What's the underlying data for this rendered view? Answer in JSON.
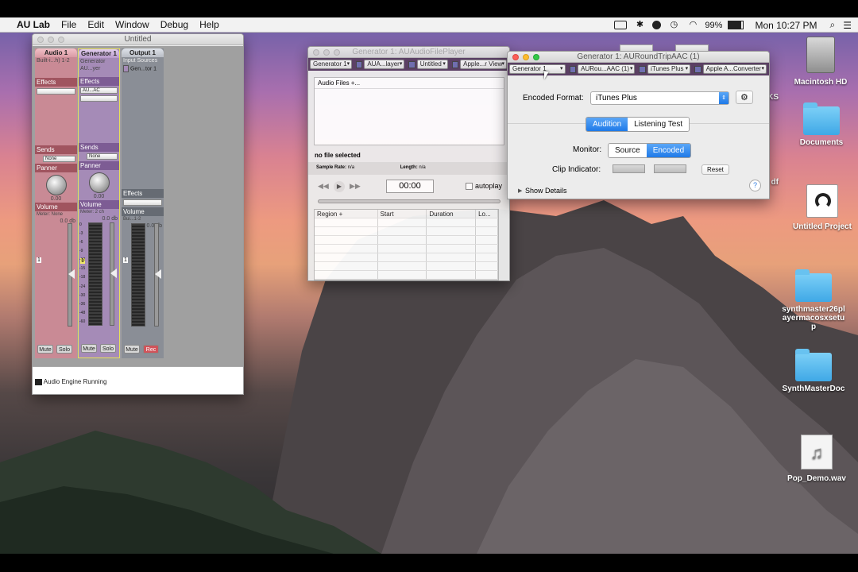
{
  "menubar": {
    "app_name": "AU Lab",
    "menus": [
      "File",
      "Edit",
      "Window",
      "Debug",
      "Help"
    ],
    "battery": "99%",
    "clock": "Mon 10:27 PM"
  },
  "main_window": {
    "title": "Untitled",
    "status": "Audio Engine Running",
    "strips": [
      {
        "header": "Audio 1",
        "input": "Built-i...h) 1-2",
        "effects_label": "Effects",
        "sends_label": "Sends",
        "send_value": "None",
        "panner_label": "Panner",
        "pan_value": "0.00",
        "volume_label": "Volume",
        "meter_label": "Meter: None",
        "db": "0.0",
        "mute": "Mute",
        "solo": "Solo",
        "track": "1"
      },
      {
        "header": "Generator 1",
        "input": "Generator",
        "plugin": "AU...yer",
        "effects_label": "Effects",
        "effect_value": "AU...AC",
        "sends_label": "Sends",
        "send_value": "None",
        "panner_label": "Panner",
        "pan_value": "0.00",
        "volume_label": "Volume",
        "meter_label": "Meter: 2 ch",
        "db": "0.0",
        "mute": "Mute",
        "solo": "Solo",
        "track": "1"
      },
      {
        "header": "Output 1",
        "input": "Input Sources",
        "source": "Gen...tor 1",
        "effects_label": "Effects",
        "volume_label": "Volume",
        "meter_label": "Bui...1-2",
        "db": "0.0",
        "mute": "Mute",
        "rec": "Rec",
        "track": "1"
      }
    ],
    "meter_scale": [
      "0",
      "-3",
      "-6",
      "-9",
      "-12",
      "-15",
      "-18",
      "-24",
      "-30",
      "-36",
      "-48",
      "-60"
    ],
    "db_unit": "db"
  },
  "player_window": {
    "title": "Generator 1: AUAudioFilePlayer",
    "toolbar": [
      "Generator 1",
      "AUA...layer",
      "Untitled",
      "Apple...r View"
    ],
    "audio_files_label": "Audio Files +...",
    "no_file": "no file selected",
    "sample_rate_label": "Sample Rate:",
    "sample_rate_value": "n/a",
    "length_label": "Length:",
    "length_value": "n/a",
    "time": "00:00",
    "autoplay": "autoplay",
    "columns": [
      "Region +",
      "Start",
      "Duration",
      "Lo..."
    ]
  },
  "aac_window": {
    "title": "Generator 1: AURoundTripAAC (1)",
    "toolbar": [
      "Generator 1",
      "AURou...AAC (1)",
      "iTunes Plus",
      "Apple A...Converter"
    ],
    "encoded_format_label": "Encoded Format:",
    "encoded_format_value": "iTunes Plus",
    "tabs": [
      "Audition",
      "Listening Test"
    ],
    "monitor_label": "Monitor:",
    "monitor_options": [
      "Source",
      "Encoded"
    ],
    "clip_label": "Clip Indicator:",
    "reset": "Reset",
    "show_details": "Show Details",
    "help": "?"
  },
  "desktop_icons": [
    {
      "label": "Macintosh HD"
    },
    {
      "label": "Documents"
    },
    {
      "label": "Untitled Project"
    },
    {
      "label": "synthmaster26playermacosxsetup"
    },
    {
      "label": "SynthMasterDoc"
    },
    {
      "label": "Pop_Demo.wav"
    }
  ],
  "partial_labels": [
    "KS",
    "df"
  ]
}
